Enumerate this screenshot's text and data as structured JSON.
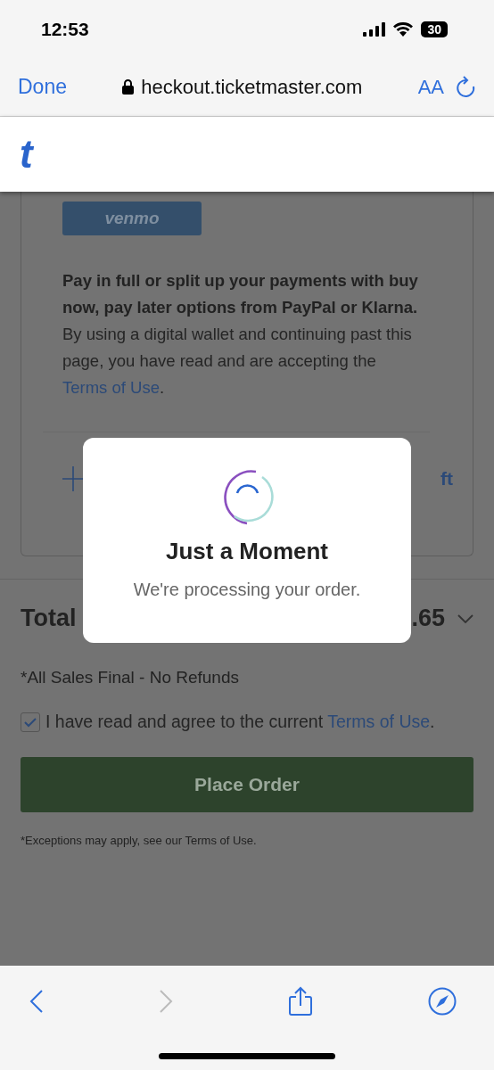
{
  "status_bar": {
    "time": "12:53",
    "battery": "30"
  },
  "browser_bar": {
    "done": "Done",
    "url": "heckout.ticketmaster.com",
    "text_size": "AA"
  },
  "site_header": {
    "logo": "t"
  },
  "payment_card": {
    "venmo": "venmo",
    "info": "Pay in full or split up your payments with buy now, pay later options from PayPal or Klarna.",
    "wallet_notice_before": "By using a digital wallet and continuing past this page, you have read and are accepting the ",
    "wallet_notice_link": "Terms of Use",
    "wallet_notice_after": ".",
    "gift_label_visible": "ft"
  },
  "total": {
    "label": "Total",
    "amount_visible": ".65"
  },
  "sales_notice": "*All Sales Final - No Refunds",
  "agree": {
    "checked": true,
    "text": "I have read and agree to the current ",
    "link": "Terms of Use",
    "after": "."
  },
  "place_order": {
    "label": "Place Order",
    "disabled": true
  },
  "exceptions": "*Exceptions may apply, see our Terms of Use.",
  "modal": {
    "title": "Just a Moment",
    "message": "We're processing your order."
  },
  "toolbar": {
    "back_disabled": false,
    "forward_disabled": true
  }
}
